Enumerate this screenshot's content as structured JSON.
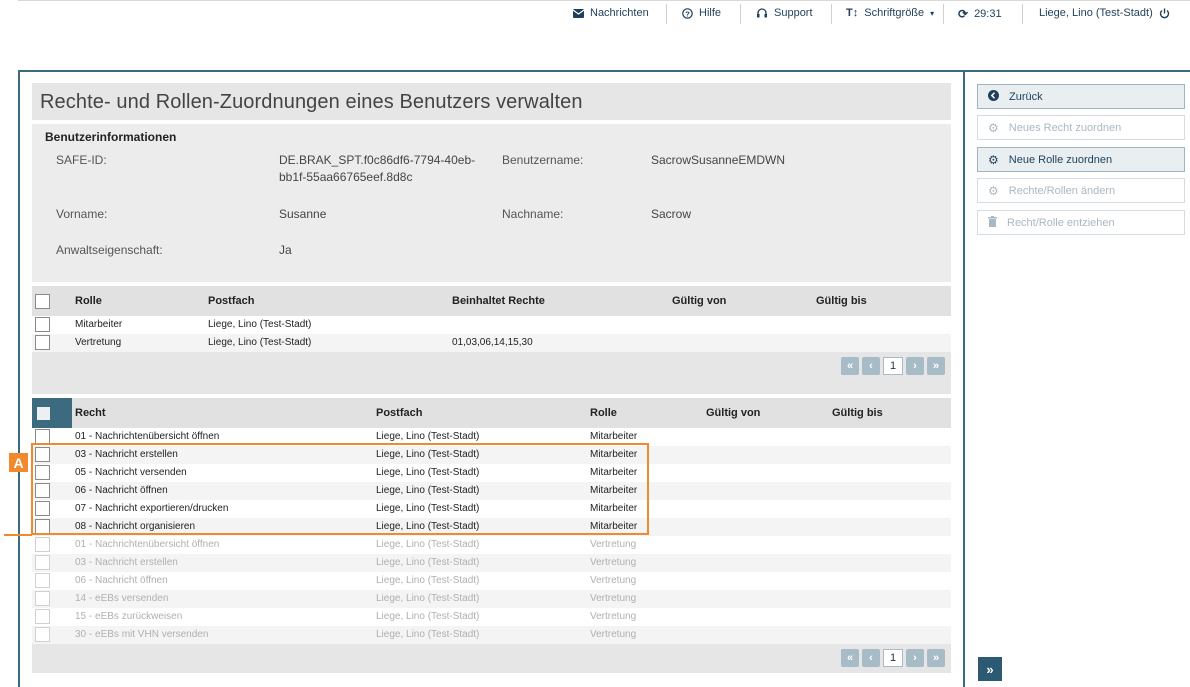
{
  "topbar": {
    "messages": "Nachrichten",
    "help": "Hilfe",
    "support": "Support",
    "fontsize": "Schriftgröße",
    "timer": "29:31",
    "user": "Liege, Lino (Test-Stadt)"
  },
  "page": {
    "title": "Rechte- und Rollen-Zuordnungen eines Benutzers verwalten"
  },
  "info": {
    "heading": "Benutzerinformationen",
    "safe_label": "SAFE-ID:",
    "safe_value_1": "DE.BRAK_SPT.f0c86df6-7794-40eb-",
    "safe_value_2": "bb1f-55aa66765eef.8d8c",
    "username_label": "Benutzername:",
    "username_value": "SacrowSusanneEMDWN",
    "firstname_label": "Vorname:",
    "firstname_value": "Susanne",
    "lastname_label": "Nachname:",
    "lastname_value": "Sacrow",
    "lawyer_label": "Anwaltseigenschaft:",
    "lawyer_value": "Ja"
  },
  "roles_table": {
    "headers": [
      "Rolle",
      "Postfach",
      "Beinhaltet Rechte",
      "Gültig von",
      "Gültig bis"
    ],
    "rows": [
      {
        "rolle": "Mitarbeiter",
        "postfach": "Liege, Lino (Test-Stadt)",
        "rechte": ""
      },
      {
        "rolle": "Vertretung",
        "postfach": "Liege, Lino (Test-Stadt)",
        "rechte": "01,03,06,14,15,30"
      }
    ],
    "page": "1"
  },
  "rights_table": {
    "headers": [
      "Recht",
      "Postfach",
      "Rolle",
      "Gültig von",
      "Gültig bis"
    ],
    "rows": [
      {
        "recht": "01 - Nachrichtenübersicht öffnen",
        "postfach": "Liege, Lino (Test-Stadt)",
        "rolle": "Mitarbeiter"
      },
      {
        "recht": "03 - Nachricht erstellen",
        "postfach": "Liege, Lino (Test-Stadt)",
        "rolle": "Mitarbeiter"
      },
      {
        "recht": "05 - Nachricht versenden",
        "postfach": "Liege, Lino (Test-Stadt)",
        "rolle": "Mitarbeiter"
      },
      {
        "recht": "06 - Nachricht öffnen",
        "postfach": "Liege, Lino (Test-Stadt)",
        "rolle": "Mitarbeiter"
      },
      {
        "recht": "07 - Nachricht exportieren/drucken",
        "postfach": "Liege, Lino (Test-Stadt)",
        "rolle": "Mitarbeiter"
      },
      {
        "recht": "08 - Nachricht organisieren",
        "postfach": "Liege, Lino (Test-Stadt)",
        "rolle": "Mitarbeiter"
      },
      {
        "recht": "01 - Nachrichtenübersicht öffnen",
        "postfach": "Liege, Lino (Test-Stadt)",
        "rolle": "Vertretung"
      },
      {
        "recht": "03 - Nachricht erstellen",
        "postfach": "Liege, Lino (Test-Stadt)",
        "rolle": "Vertretung"
      },
      {
        "recht": "06 - Nachricht öffnen",
        "postfach": "Liege, Lino (Test-Stadt)",
        "rolle": "Vertretung"
      },
      {
        "recht": "14 - eEBs versenden",
        "postfach": "Liege, Lino (Test-Stadt)",
        "rolle": "Vertretung"
      },
      {
        "recht": "15 - eEBs zurückweisen",
        "postfach": "Liege, Lino (Test-Stadt)",
        "rolle": "Vertretung"
      },
      {
        "recht": "30 - eEBs mit VHN versenden",
        "postfach": "Liege, Lino (Test-Stadt)",
        "rolle": "Vertretung"
      }
    ],
    "page": "1"
  },
  "actions": {
    "back": "Zurück",
    "new_right": "Neues Recht zuordnen",
    "new_role": "Neue Rolle zuordnen",
    "change": "Rechte/Rollen ändern",
    "revoke": "Recht/Rolle entziehen"
  },
  "annotation": {
    "label": "A",
    "color": "#f08a2c"
  },
  "colors": {
    "accent": "#3c6b80",
    "pager": "#a8bcc8"
  }
}
